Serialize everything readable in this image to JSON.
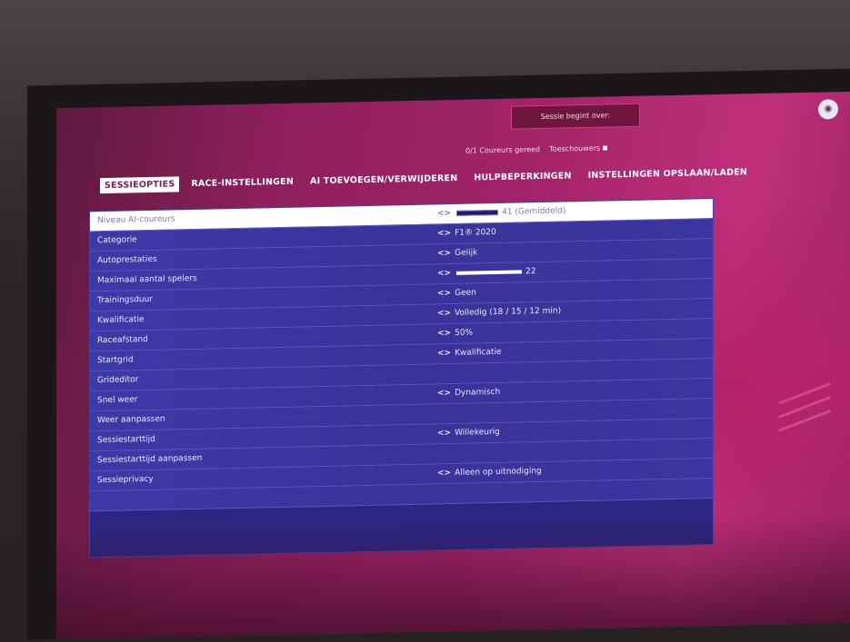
{
  "header": {
    "status": "Sessie begint over:",
    "counters": {
      "drivers": "0/1 Coureurs gereed",
      "spectators": "Toeschouwers"
    }
  },
  "tabs": [
    {
      "label": "SESSIEOPTIES",
      "active": true
    },
    {
      "label": "RACE-INSTELLINGEN",
      "active": false
    },
    {
      "label": "AI TOEVOEGEN/VERWIJDEREN",
      "active": false
    },
    {
      "label": "HULPBEPERKINGEN",
      "active": false
    },
    {
      "label": "INSTELLINGEN OPSLAAN/LADEN",
      "active": false
    }
  ],
  "settings": [
    {
      "label": "Niveau AI-coureurs",
      "value": "41 (Gemiddeld)",
      "arrows": "<>",
      "bar": "dark",
      "bar_level": 0.41
    },
    {
      "label": "Categorie",
      "value": "F1® 2020",
      "arrows": "<>"
    },
    {
      "label": "Autoprestaties",
      "value": "Gelijk",
      "arrows": "<>"
    },
    {
      "label": "Maximaal aantal spelers",
      "value": "22",
      "arrows": "<>",
      "bar": "white",
      "bar_level": 1.0
    },
    {
      "label": "Trainingsduur",
      "value": "Geen",
      "arrows": "<>"
    },
    {
      "label": "Kwalificatie",
      "value": "Volledig (18 / 15 / 12 min)",
      "arrows": "<>"
    },
    {
      "label": "Raceafstand",
      "value": "50%",
      "arrows": "<>"
    },
    {
      "label": "Startgrid",
      "value": "Kwalificatie",
      "arrows": "<>"
    },
    {
      "label": "Grideditor",
      "value": "",
      "arrows": ""
    },
    {
      "label": "Snel weer",
      "value": "Dynamisch",
      "arrows": "<>"
    },
    {
      "label": "Weer aanpassen",
      "value": "",
      "arrows": ""
    },
    {
      "label": "Sessiestarttijd",
      "value": "Willekeurig",
      "arrows": "<>"
    },
    {
      "label": "Sessiestarttijd aanpassen",
      "value": "",
      "arrows": ""
    },
    {
      "label": "Sessieprivacy",
      "value": "Alleen op uitnodiging",
      "arrows": "<>"
    },
    {
      "label": "",
      "value": "",
      "arrows": ""
    }
  ],
  "colors": {
    "accent": "#a3236a",
    "panel": "#2c2680",
    "row": "#3e39a8",
    "selected_row": "#ffffff"
  },
  "icons": {
    "top_right": "controller-icon"
  }
}
